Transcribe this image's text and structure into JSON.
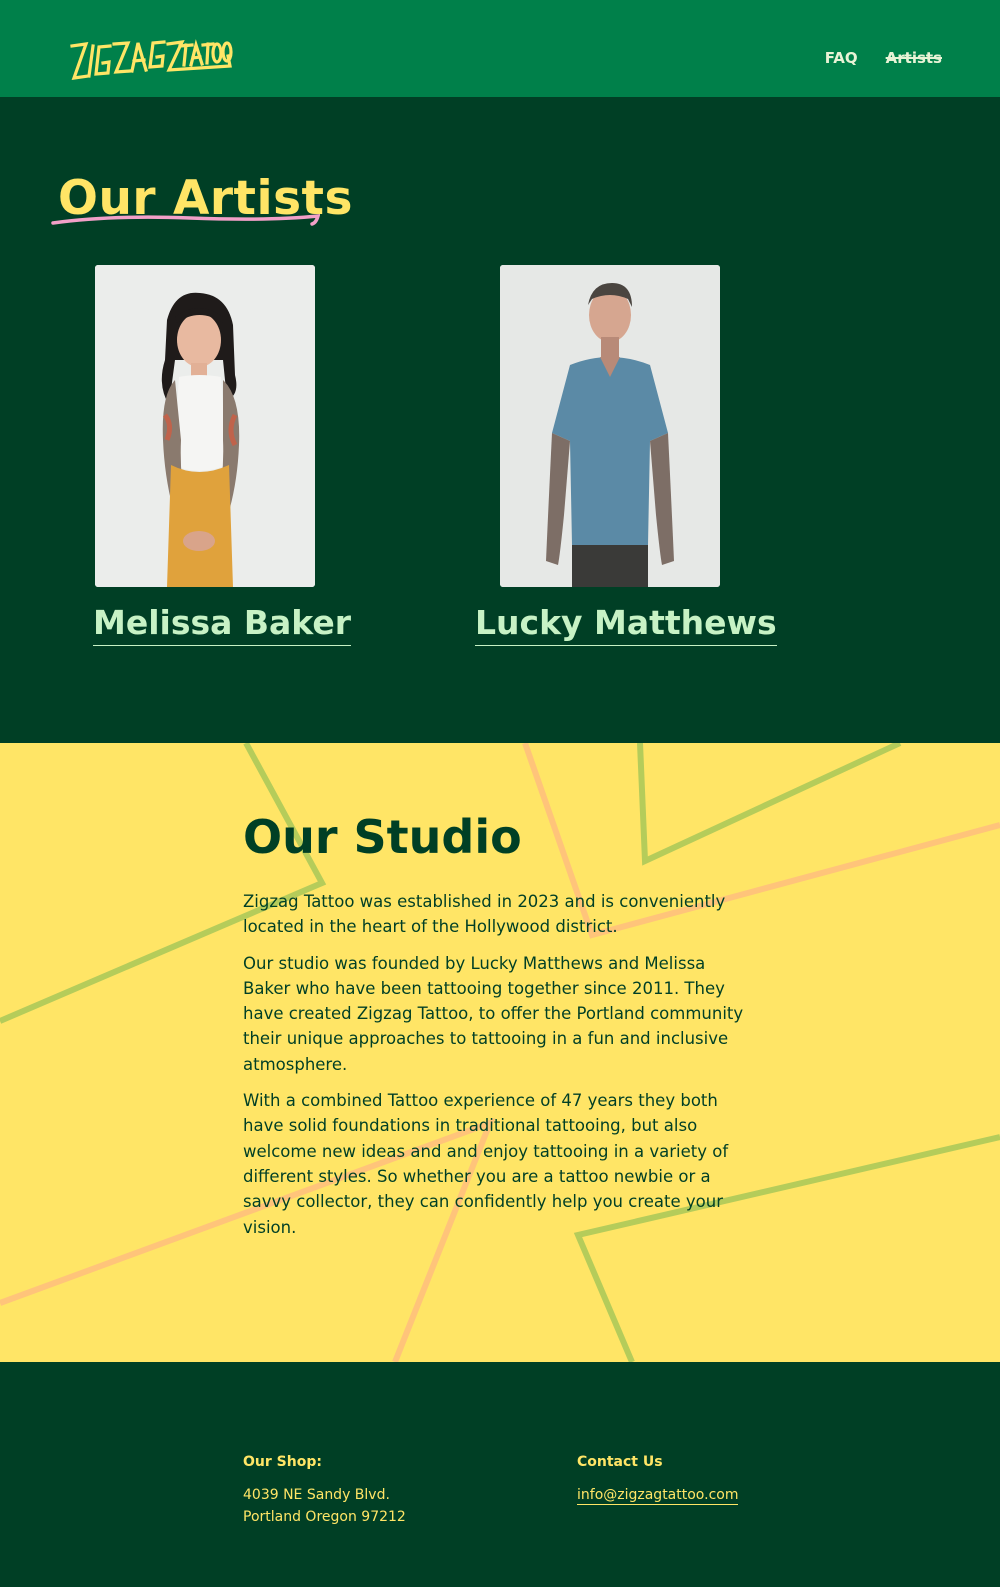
{
  "header": {
    "logo_text": "ZIGZAG TATTOO",
    "nav": [
      {
        "label": "FAQ"
      },
      {
        "label": "Artists"
      }
    ]
  },
  "artists": {
    "title": "Our Artists",
    "list": [
      {
        "name": "Melissa Baker"
      },
      {
        "name": "Lucky Matthews"
      }
    ]
  },
  "studio": {
    "title": "Our Studio",
    "paragraphs": [
      "Zigzag Tattoo was established in 2023 and is conveniently located in the heart of the Hollywood district.",
      "Our studio was founded by Lucky Matthews and Melissa Baker who have been tattooing together since 2011. They have created Zigzag Tattoo, to offer the Portland community their unique approaches to tattooing in a fun and inclusive atmosphere.",
      "With a combined Tattoo experience of 47 years they both have solid foundations in traditional tattooing, but also welcome new ideas and and enjoy tattooing in a variety of different styles. So whether you are a tattoo newbie or a savvy collector, they can confidently help you create your vision."
    ]
  },
  "footer": {
    "shop_heading": "Our Shop:",
    "address_line1": "4039 NE Sandy Blvd.",
    "address_line2": "Portland Oregon 97212",
    "contact_heading": "Contact Us",
    "email": "info@zigzagtattoo.com"
  },
  "colors": {
    "header_green": "#00804a",
    "dark_green": "#003f25",
    "yellow": "#ffe566",
    "mint": "#c7f2c5",
    "pink": "#f2a0c8"
  }
}
